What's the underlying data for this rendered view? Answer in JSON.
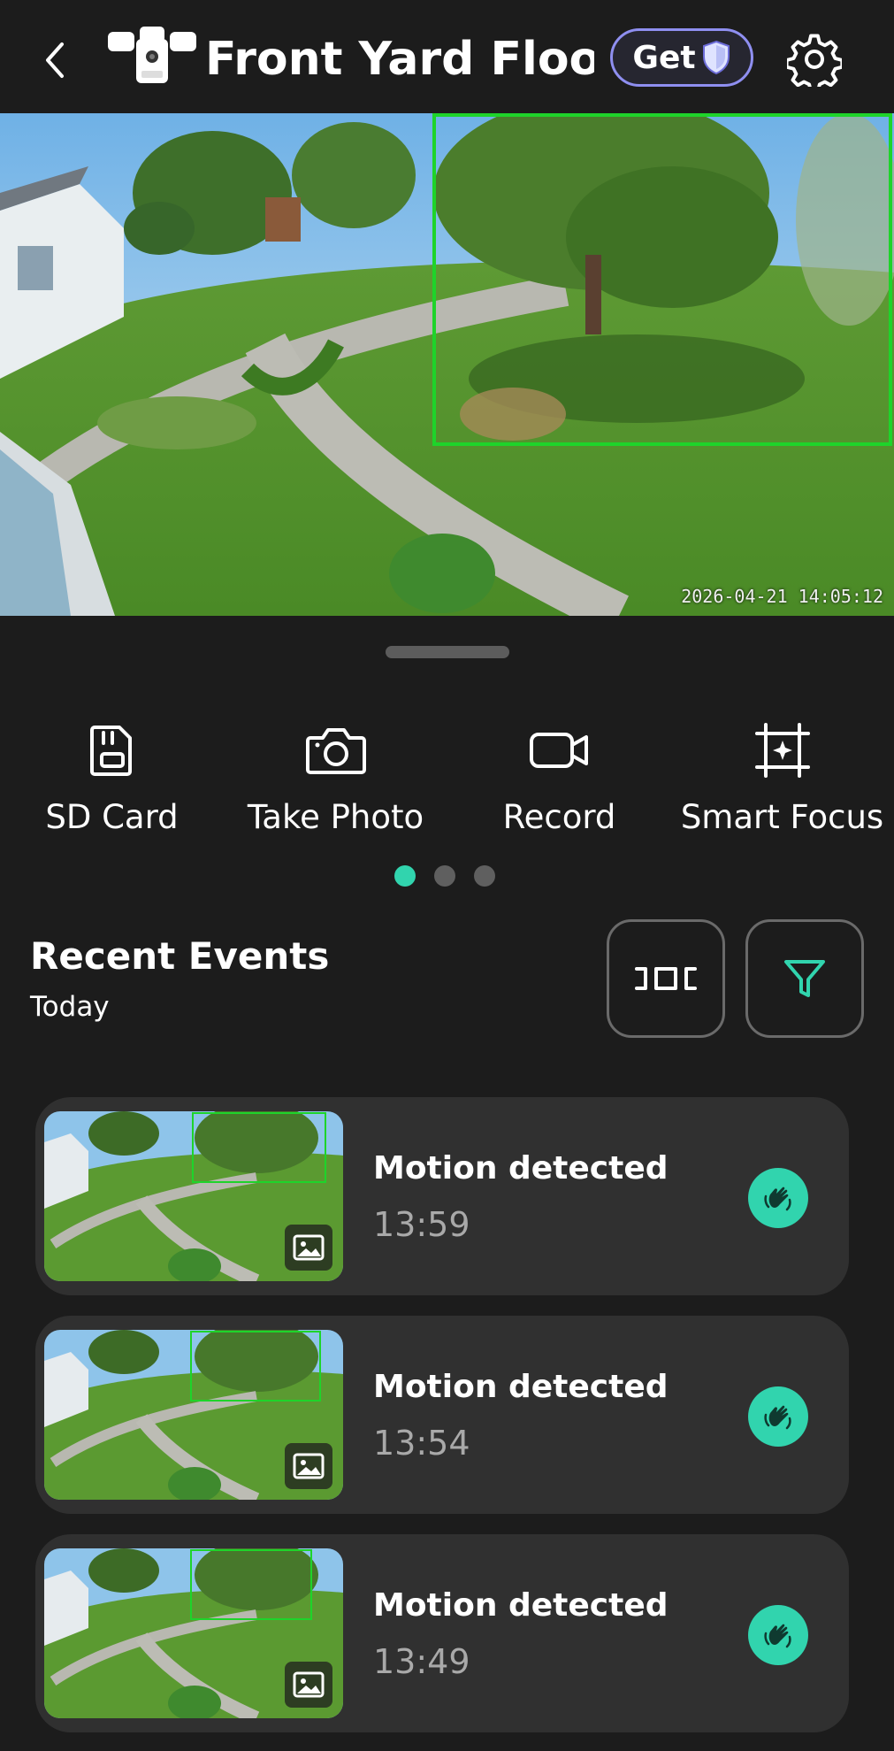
{
  "header": {
    "title": "Front Yard Floo...",
    "get_label": "Get",
    "back_icon": "chevron-left-icon",
    "device_icon": "floodlight-camera-icon",
    "badge_icon": "shield-icon",
    "settings_icon": "gear-icon"
  },
  "feed": {
    "timestamp": "2026-04-21  14:05:12",
    "detection_box_color": "#1ed42a"
  },
  "actions": [
    {
      "label": "SD Card",
      "icon": "sd-card-icon"
    },
    {
      "label": "Take Photo",
      "icon": "camera-icon"
    },
    {
      "label": "Record",
      "icon": "video-camera-icon"
    },
    {
      "label": "Smart Focus",
      "icon": "focus-frame-icon"
    }
  ],
  "pager": {
    "pages": 3,
    "active": 1
  },
  "events": {
    "title": "Recent Events",
    "day": "Today",
    "timeline_button_icon": "timeline-icon",
    "filter_button_icon": "filter-icon",
    "items": [
      {
        "title": "Motion detected",
        "time": "13:59",
        "icon": "motion-hand-icon"
      },
      {
        "title": "Motion detected",
        "time": "13:54",
        "icon": "motion-hand-icon"
      },
      {
        "title": "Motion detected",
        "time": "13:49",
        "icon": "motion-hand-icon"
      }
    ]
  },
  "colors": {
    "background": "#1c1c1c",
    "card": "#303030",
    "accent": "#31d4ae",
    "badge_border": "#8f8ff0"
  }
}
